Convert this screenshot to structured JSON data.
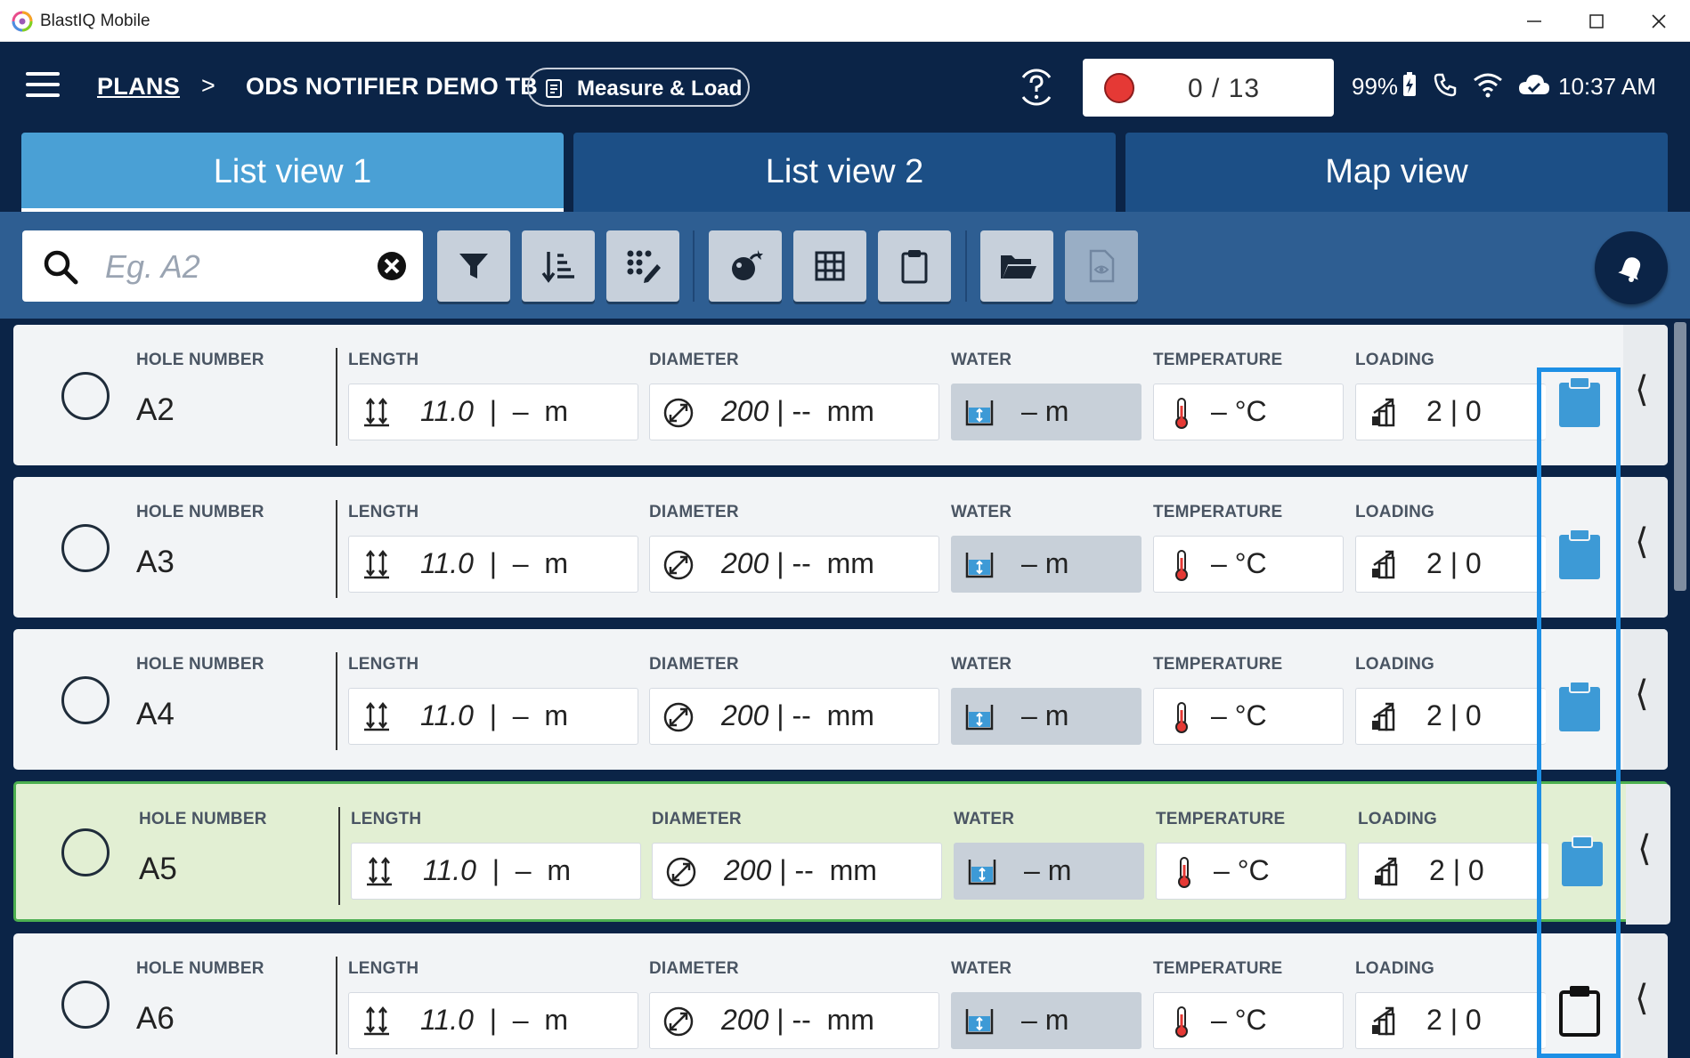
{
  "window": {
    "title": "BlastIQ Mobile"
  },
  "header": {
    "breadcrumb_root": "PLANS",
    "breadcrumb_sep": ">",
    "plan_name": "ODS NOTIFIER DEMO TB",
    "mode_label": "Measure & Load",
    "progress": "0 / 13",
    "battery": "99%",
    "time": "10:37 AM"
  },
  "tabs": [
    {
      "label": "List view 1",
      "active": true
    },
    {
      "label": "List view 2",
      "active": false
    },
    {
      "label": "Map view",
      "active": false
    }
  ],
  "search": {
    "placeholder": "Eg. A2"
  },
  "toolbar": {
    "buttons": [
      "filter-icon",
      "sort-icon",
      "multi-select-icon",
      "explosive-icon",
      "table-icon",
      "clipboard-icon",
      "folder-open-icon",
      "document-view-icon"
    ],
    "fab": "notification-bell-icon"
  },
  "columns": {
    "hole": "HOLE NUMBER",
    "length": "LENGTH",
    "diameter": "DIAMETER",
    "water": "WATER",
    "temperature": "TEMPERATURE",
    "loading": "LOADING"
  },
  "rows": [
    {
      "hole": "A2",
      "length": "11.0",
      "length_rest": "  |  –  m",
      "diameter": "200",
      "diameter_rest": " | --  mm",
      "water": "– m",
      "temperature": "– °C",
      "loading": "2 | 0",
      "selected": false,
      "clipboard": "filled"
    },
    {
      "hole": "A3",
      "length": "11.0",
      "length_rest": "  |  –  m",
      "diameter": "200",
      "diameter_rest": " | --  mm",
      "water": "– m",
      "temperature": "– °C",
      "loading": "2 | 0",
      "selected": false,
      "clipboard": "filled"
    },
    {
      "hole": "A4",
      "length": "11.0",
      "length_rest": "  |  –  m",
      "diameter": "200",
      "diameter_rest": " | --  mm",
      "water": "– m",
      "temperature": "– °C",
      "loading": "2 | 0",
      "selected": false,
      "clipboard": "filled"
    },
    {
      "hole": "A5",
      "length": "11.0",
      "length_rest": "  |  –  m",
      "diameter": "200",
      "diameter_rest": " | --  mm",
      "water": "– m",
      "temperature": "– °C",
      "loading": "2 | 0",
      "selected": true,
      "clipboard": "filled"
    },
    {
      "hole": "A6",
      "length": "11.0",
      "length_rest": "  |  –  m",
      "diameter": "200",
      "diameter_rest": " | --  mm",
      "water": "– m",
      "temperature": "– °C",
      "loading": "2 | 0",
      "selected": false,
      "clipboard": "outline"
    }
  ],
  "colors": {
    "header_bg": "#0b2447",
    "tab_active": "#4aa0d5",
    "tab_inactive": "#1c4f86",
    "toolbar_bg": "#2e5e92",
    "selected_row": "#e2efd3",
    "selected_border": "#4caf50",
    "clipboard_blue": "#3d9ad6",
    "highlight": "#1d8fe5",
    "record_red": "#e53935"
  }
}
